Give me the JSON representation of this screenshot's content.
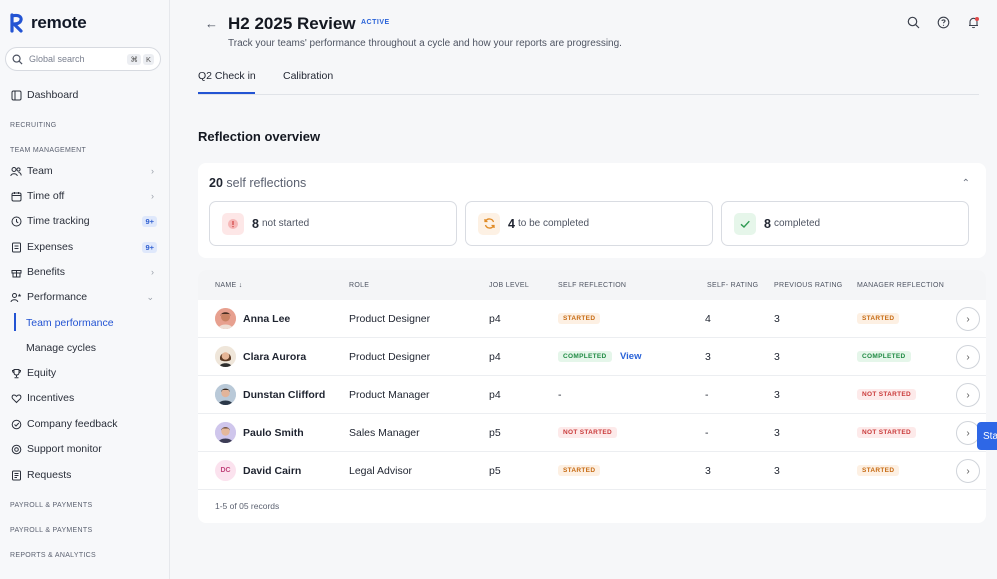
{
  "sidebar": {
    "brand": "remote",
    "search_placeholder": "Global search",
    "search_kbd_1": "⌘",
    "search_kbd_2": "K",
    "dashboard": "Dashboard",
    "section_recruiting": "RECRUITING",
    "section_team_management": "TEAM MANAGEMENT",
    "team": "Team",
    "time_off": "Time off",
    "time_tracking": "Time tracking",
    "time_tracking_badge": "9+",
    "expenses": "Expenses",
    "expenses_badge": "9+",
    "benefits": "Benefits",
    "performance": "Performance",
    "team_performance": "Team performance",
    "manage_cycles": "Manage cycles",
    "equity": "Equity",
    "incentives": "Incentives",
    "company_feedback": "Company feedback",
    "support_monitor": "Support monitor",
    "requests": "Requests",
    "section_payroll_1": "PAYROLL & PAYMENTS",
    "section_payroll_2": "PAYROLL & PAYMENTS",
    "section_reports": "REPORTS & ANALYTICS"
  },
  "header": {
    "title": "H2 2025 Review",
    "status": "ACTIVE",
    "subtitle": "Track your teams' performance throughout a cycle and how your reports are progressing."
  },
  "tabs": {
    "tab1": "Q2 Check in",
    "tab2": "Calibration"
  },
  "overview": {
    "title": "Reflection overview",
    "count": "20",
    "count_label": "self reflections",
    "stats": [
      {
        "value": "8",
        "label": "not started"
      },
      {
        "value": "4",
        "label": "to be completed"
      },
      {
        "value": "8",
        "label": "completed"
      }
    ]
  },
  "table": {
    "headers": {
      "name": "NAME",
      "role": "ROLE",
      "job_level": "JOB LEVEL",
      "self_reflection": "SELF REFLECTION",
      "self_rating": "SELF- RATING",
      "previous_rating": "PREVIOUS RATING",
      "manager_reflection": "MANAGER REFLECTION"
    },
    "rows": [
      {
        "name": "Anna Lee",
        "role": "Product Designer",
        "level": "p4",
        "self_reflection": "STARTED",
        "view": "",
        "self_rating": "4",
        "previous_rating": "3",
        "manager_reflection": "STARTED"
      },
      {
        "name": "Clara Aurora",
        "role": "Product Designer",
        "level": "p4",
        "self_reflection": "COMPLETED",
        "view": "View",
        "self_rating": "3",
        "previous_rating": "3",
        "manager_reflection": "COMPLETED"
      },
      {
        "name": "Dunstan Clifford",
        "role": "Product Manager",
        "level": "p4",
        "self_reflection": "-",
        "view": "",
        "self_rating": "-",
        "previous_rating": "3",
        "manager_reflection": "NOT STARTED"
      },
      {
        "name": "Paulo Smith",
        "role": "Sales Manager",
        "level": "p5",
        "self_reflection": "NOT STARTED",
        "view": "",
        "self_rating": "-",
        "previous_rating": "3",
        "manager_reflection": "NOT STARTED"
      },
      {
        "name": "David Cairn",
        "initials": "DC",
        "role": "Legal Advisor",
        "level": "p5",
        "self_reflection": "STARTED",
        "view": "",
        "self_rating": "3",
        "previous_rating": "3",
        "manager_reflection": "STARTED"
      }
    ],
    "footer": "1-5 of 05 records"
  },
  "side_tab": "Sta",
  "colors": {
    "accent": "#2354d3",
    "started": "#c66a12",
    "completed": "#1f8a43",
    "not_started": "#c93a3a"
  }
}
